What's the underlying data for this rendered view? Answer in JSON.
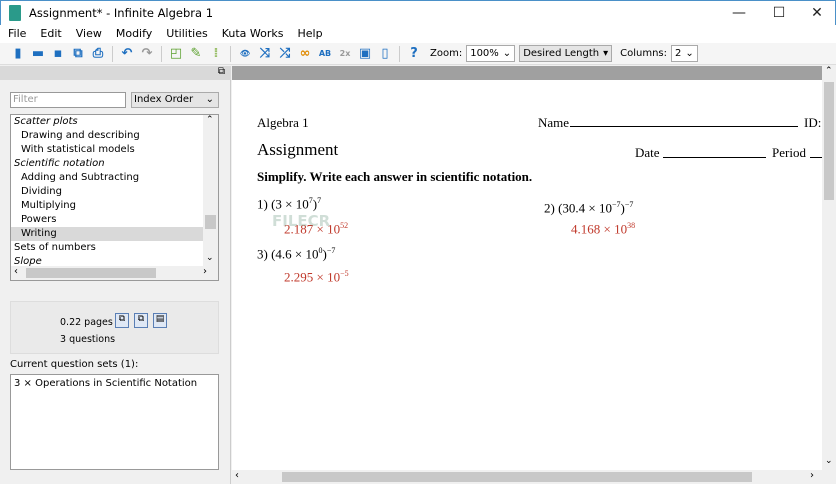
{
  "window": {
    "title": "Assignment* - Infinite Algebra 1",
    "min": "—",
    "max": "☐",
    "close": "✕"
  },
  "menu": [
    "File",
    "Edit",
    "View",
    "Modify",
    "Utilities",
    "Kuta Works",
    "Help"
  ],
  "toolbar": {
    "icons": [
      {
        "name": "new-icon",
        "glyph": "▮",
        "color": "#1e6fc0"
      },
      {
        "name": "open-icon",
        "glyph": "▬",
        "color": "#1e6fc0"
      },
      {
        "name": "save-icon",
        "glyph": "▪",
        "color": "#1e6fc0"
      },
      {
        "name": "save-as-icon",
        "glyph": "⧉",
        "color": "#1e6fc0"
      },
      {
        "name": "print-icon",
        "glyph": "⎙",
        "color": "#1e6fc0"
      },
      {
        "name": "undo-icon",
        "glyph": "↶",
        "color": "#1e6fc0"
      },
      {
        "name": "redo-icon",
        "glyph": "↷",
        "color": "#999999"
      },
      {
        "name": "page-icon",
        "glyph": "◰",
        "color": "#5aa02c"
      },
      {
        "name": "edit-icon",
        "glyph": "✎",
        "color": "#5aa02c"
      },
      {
        "name": "number-icon",
        "glyph": "⁞",
        "color": "#9bc06b"
      },
      {
        "name": "view-icon",
        "glyph": "👁",
        "color": "#1e6fc0"
      },
      {
        "name": "shuffle-choices-icon",
        "glyph": "⤨",
        "color": "#1e6fc0"
      },
      {
        "name": "shuffle-icon",
        "glyph": "⤮",
        "color": "#1e6fc0"
      },
      {
        "name": "link-icon",
        "glyph": "∞",
        "color": "#e08a00"
      },
      {
        "name": "abcd-icon",
        "glyph": "AB",
        "color": "#1e6fc0"
      },
      {
        "name": "exponent-icon",
        "glyph": "2x",
        "color": "#999999"
      },
      {
        "name": "presentation-icon",
        "glyph": "▣",
        "color": "#1e6fc0"
      },
      {
        "name": "document-icon",
        "glyph": "▯",
        "color": "#1e6fc0"
      },
      {
        "name": "help-icon",
        "glyph": "?",
        "color": "#1e6fc0"
      }
    ],
    "zoom_label": "Zoom:",
    "zoom_value": "100%",
    "length_value": "Desired Length",
    "columns_label": "Columns:",
    "columns_value": "2"
  },
  "left": {
    "filter_placeholder": "Filter",
    "order": "Index Order",
    "tree": [
      {
        "label": "Scatter plots",
        "type": "it"
      },
      {
        "label": "Drawing and describing",
        "type": "sub"
      },
      {
        "label": "With statistical models",
        "type": "sub"
      },
      {
        "label": "Scientific notation",
        "type": "it"
      },
      {
        "label": "Adding and Subtracting",
        "type": "sub"
      },
      {
        "label": "Dividing",
        "type": "sub"
      },
      {
        "label": "Multiplying",
        "type": "sub"
      },
      {
        "label": "Powers",
        "type": "sub"
      },
      {
        "label": "Writing",
        "type": "sub sel"
      },
      {
        "label": "Sets of numbers",
        "type": ""
      },
      {
        "label": "Slope",
        "type": "it"
      }
    ],
    "pages": "0.22 pages",
    "questions": "3 questions",
    "current_label": "Current question sets (1):",
    "current_sets": "3 × Operations in Scientific Notation"
  },
  "doc": {
    "course": "Algebra 1",
    "name_label": "Name",
    "id_label": "ID:",
    "title": "Assignment",
    "date_label": "Date",
    "period_label": "Period",
    "instructions": "Simplify.  Write each answer in scientific notation.",
    "q1": {
      "num": "1)",
      "base": "(3 × 10",
      "e1": "7",
      "e2": "7",
      "ans": "2.187 × 10",
      "ans_e": "52"
    },
    "q2": {
      "num": "2)",
      "base": "(30.4 × 10",
      "e1": "−7",
      "e2": "−7",
      "ans": "4.168 × 10",
      "ans_e": "38"
    },
    "q3": {
      "num": "3)",
      "base": "(4.6 × 10",
      "e1": "0",
      "e2": "−7",
      "ans": "2.295 × 10",
      "ans_e": "−5"
    },
    "watermark": "FILECR"
  }
}
